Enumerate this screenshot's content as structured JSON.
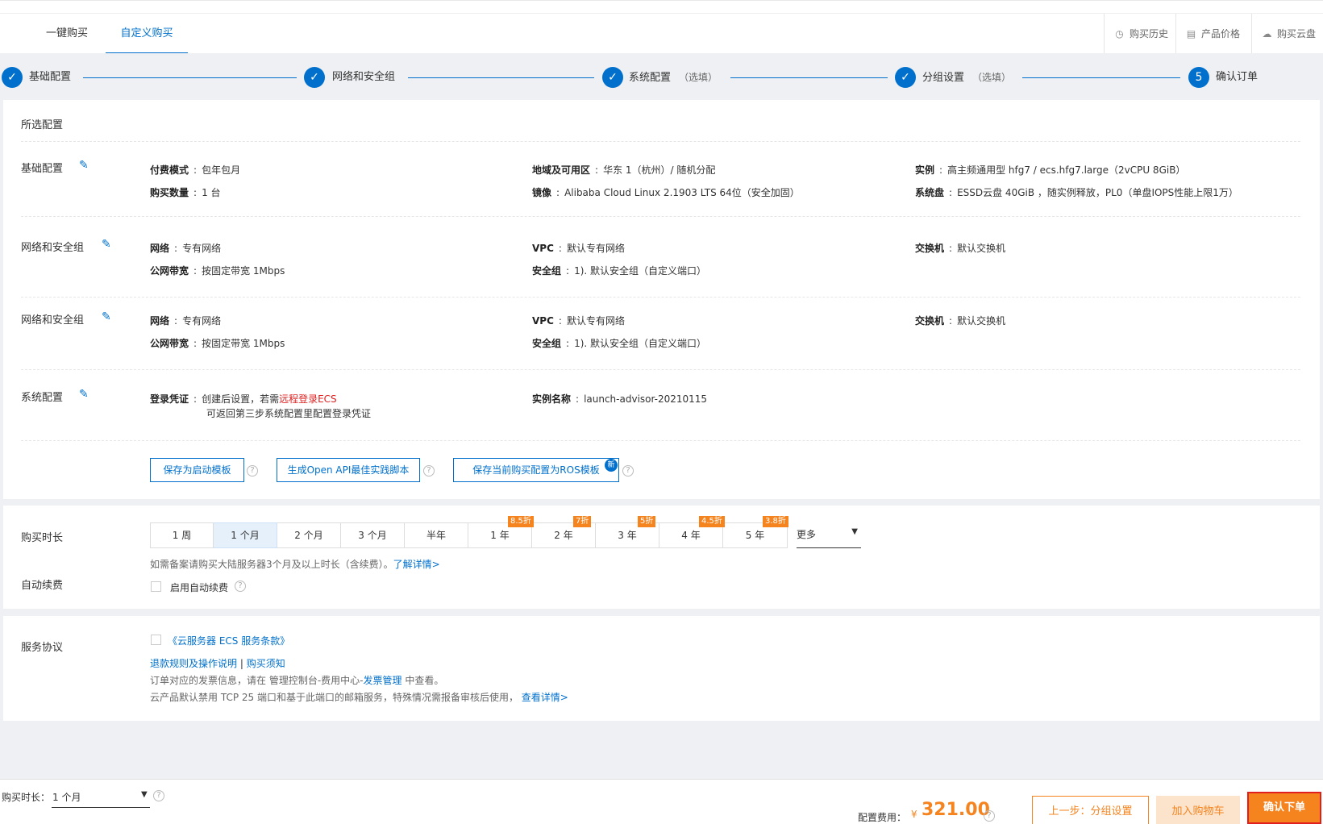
{
  "tabs": [
    "一键购买",
    "自定义购买"
  ],
  "top_links": [
    "购买历史",
    "产品价格",
    "购买云盘"
  ],
  "steps": [
    {
      "label": "基础配置",
      "optional": ""
    },
    {
      "label": "网络和安全组",
      "optional": ""
    },
    {
      "label": "系统配置",
      "optional": "（选填）"
    },
    {
      "label": "分组设置",
      "optional": "（选填）"
    },
    {
      "label": "确认订单",
      "optional": "",
      "number": "5"
    }
  ],
  "summary": {
    "title": "所选配置",
    "basic": {
      "title": "基础配置",
      "pay_mode_k": "付费模式",
      "pay_mode_v": "包年包月",
      "qty_k": "购买数量",
      "qty_v": "1 台",
      "region_k": "地域及可用区",
      "region_v": "华东 1（杭州）/ 随机分配",
      "image_k": "镜像",
      "image_v": "Alibaba Cloud Linux 2.1903 LTS 64位（安全加固）",
      "instance_k": "实例",
      "instance_v": "高主频通用型 hfg7 / ecs.hfg7.large（2vCPU 8GiB）",
      "disk_k": "系统盘",
      "disk_v": "ESSD云盘 40GiB ，随实例释放，PL0（单盘IOPS性能上限1万）"
    },
    "network": {
      "title": "网络和安全组",
      "net_k": "网络",
      "net_v": "专有网络",
      "bw_k": "公网带宽",
      "bw_v": "按固定带宽 1Mbps",
      "vpc_k": "VPC",
      "vpc_v": "默认专有网络",
      "sg_k": "安全组",
      "sg_v": "1). 默认安全组（自定义端口）",
      "vsw_k": "交换机",
      "vsw_v": "默认交换机"
    },
    "system": {
      "title": "系统配置",
      "login_k": "登录凭证",
      "login_v1": "创建后设置，若需",
      "login_link": "远程登录ECS",
      "login_v2": "可返回第三步系统配置里配置登录凭证",
      "name_k": "实例名称",
      "name_v": "launch-advisor-20210115"
    },
    "buttons": [
      "保存为启动模板",
      "生成Open API最佳实践脚本",
      "保存当前购买配置为ROS模板"
    ],
    "new_badge": "新"
  },
  "duration": {
    "title": "购买时长",
    "options": [
      "1 周",
      "1 个月",
      "2 个月",
      "3 个月",
      "半年",
      "1 年",
      "2 年",
      "3 年",
      "4 年",
      "5 年"
    ],
    "selected": 1,
    "discounts": [
      "8.5折",
      "7折",
      "5折",
      "4.5折",
      "3.8折"
    ],
    "more": "更多",
    "note": "如需备案请购买大陆服务器3个月及以上时长（含续费）。",
    "note_link": "了解详情>",
    "auto_renew_title": "自动续费",
    "auto_renew_label": "启用自动续费"
  },
  "agreement": {
    "title": "服务协议",
    "terms": "《云服务器 ECS 服务条款》",
    "refund": "退款规则及操作说明",
    "divider": "|",
    "notice": "购买须知",
    "invoice_1": "订单对应的发票信息，请在 管理控制台-费用中心-",
    "invoice_link": "发票管理",
    "invoice_2": " 中查看。",
    "port_note": "云产品默认禁用 TCP 25 端口和基于此端口的邮箱服务，特殊情况需报备审核后使用，",
    "port_link": "查看详情>"
  },
  "bottom": {
    "duration_label": "购买时长：",
    "duration_value": "1 个月",
    "fee_label": "配置费用：",
    "currency": "¥",
    "price": "321.00",
    "prev_btn": "上一步：分组设置",
    "cart_btn": "加入购物车",
    "confirm_btn": "确认下单"
  },
  "colors": {
    "accent": "#0070cc",
    "orange": "#f5841f",
    "highlight": "#e02020"
  }
}
